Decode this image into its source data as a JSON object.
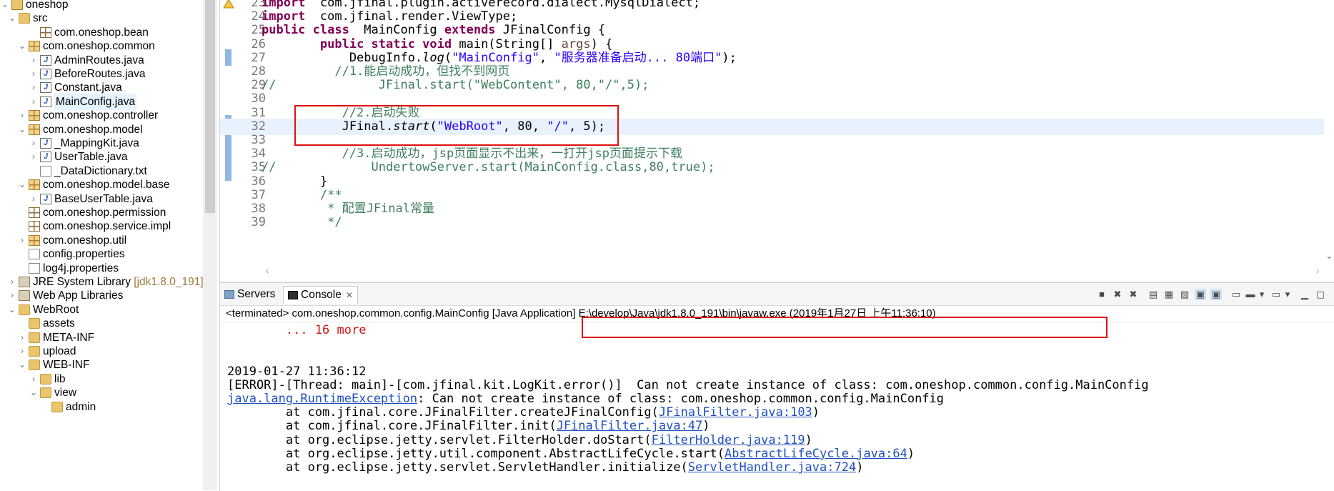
{
  "explorer": {
    "items": [
      {
        "label": "oneshop",
        "chev": "⌄",
        "icon": "proj"
      },
      {
        "label": "src",
        "chev": "⌄",
        "icon": "src"
      },
      {
        "label": "com.oneshop.bean",
        "chev": "",
        "icon": "pkg"
      },
      {
        "label": "com.oneshop.common",
        "chev": "⌄",
        "icon": "pkgfull"
      },
      {
        "label": "AdminRoutes.java",
        "chev": "›",
        "icon": "java"
      },
      {
        "label": "BeforeRoutes.java",
        "chev": "›",
        "icon": "java"
      },
      {
        "label": "Constant.java",
        "chev": "›",
        "icon": "java"
      },
      {
        "label": "MainConfig.java",
        "chev": "›",
        "icon": "java",
        "selected": true
      },
      {
        "label": "com.oneshop.controller",
        "chev": "›",
        "icon": "pkgfull"
      },
      {
        "label": "com.oneshop.model",
        "chev": "⌄",
        "icon": "pkgfull"
      },
      {
        "label": "_MappingKit.java",
        "chev": "›",
        "icon": "java"
      },
      {
        "label": "UserTable.java",
        "chev": "›",
        "icon": "java"
      },
      {
        "label": "_DataDictionary.txt",
        "chev": "",
        "icon": "file"
      },
      {
        "label": "com.oneshop.model.base",
        "chev": "⌄",
        "icon": "pkgfull"
      },
      {
        "label": "BaseUserTable.java",
        "chev": "›",
        "icon": "java"
      },
      {
        "label": "com.oneshop.permission",
        "chev": "",
        "icon": "pkg"
      },
      {
        "label": "com.oneshop.service.impl",
        "chev": "",
        "icon": "pkg"
      },
      {
        "label": "com.oneshop.util",
        "chev": "›",
        "icon": "pkgfull"
      },
      {
        "label": "config.properties",
        "chev": "",
        "icon": "file"
      },
      {
        "label": "log4j.properties",
        "chev": "",
        "icon": "file"
      },
      {
        "label": "JRE System Library",
        "deco": " [jdk1.8.0_191]",
        "chev": "›",
        "icon": "lib"
      },
      {
        "label": "Web App Libraries",
        "chev": "›",
        "icon": "lib"
      },
      {
        "label": "WebRoot",
        "chev": "⌄",
        "icon": "folder"
      },
      {
        "label": "assets",
        "chev": "",
        "icon": "folder"
      },
      {
        "label": "META-INF",
        "chev": "›",
        "icon": "folder"
      },
      {
        "label": "upload",
        "chev": "›",
        "icon": "folder"
      },
      {
        "label": "WEB-INF",
        "chev": "⌄",
        "icon": "folder"
      },
      {
        "label": "lib",
        "chev": "›",
        "icon": "folder"
      },
      {
        "label": "view",
        "chev": "⌄",
        "icon": "folder"
      },
      {
        "label": "admin",
        "chev": "",
        "icon": "folder"
      }
    ]
  },
  "editor": {
    "lines": [
      {
        "n": "23",
        "segs": [
          [
            "kw",
            "import"
          ],
          [
            "",
            "  com.jfinal.plugin.activerecord.dialect.MysqlDialect;"
          ]
        ]
      },
      {
        "n": "24",
        "segs": [
          [
            "kw",
            "import"
          ],
          [
            "",
            "  com.jfinal.render.ViewType;"
          ]
        ]
      },
      {
        "n": "25",
        "segs": [
          [
            "kw",
            "public class"
          ],
          [
            "",
            "  MainConfig "
          ],
          [
            "kw",
            "extends"
          ],
          [
            "",
            " JFinalConfig {"
          ]
        ]
      },
      {
        "n": "26",
        "segs": [
          [
            "",
            "        "
          ],
          [
            "kw",
            "public static void"
          ],
          [
            "",
            " main(String[] "
          ],
          [
            "param",
            "args"
          ],
          [
            "",
            ") {"
          ]
        ]
      },
      {
        "n": "27",
        "segs": [
          [
            "",
            "            DebugInfo."
          ],
          [
            "italic",
            "log"
          ],
          [
            "",
            "("
          ],
          [
            "str",
            "\"MainConfig\""
          ],
          [
            "",
            ", "
          ],
          [
            "str",
            "\"服务器准备启动... 80端口\""
          ],
          [
            "",
            ");"
          ]
        ]
      },
      {
        "n": "28",
        "segs": [
          [
            "cmt",
            "          //1.能启动成功，但找不到网页"
          ]
        ]
      },
      {
        "n": "29",
        "segs": [
          [
            "cmt",
            "//              JFinal.start(\"WebContent\", 80,\"/\",5);"
          ]
        ]
      },
      {
        "n": "30",
        "segs": [
          [
            "",
            ""
          ]
        ]
      },
      {
        "n": "31",
        "segs": [
          [
            "cmt",
            "           //2.启动失败"
          ]
        ]
      },
      {
        "n": "32",
        "segs": [
          [
            "",
            "           JFinal."
          ],
          [
            "italic",
            "start"
          ],
          [
            "",
            "("
          ],
          [
            "str",
            "\"WebRoot\""
          ],
          [
            "",
            ", 80, "
          ],
          [
            "str",
            "\"/\""
          ],
          [
            "",
            ", 5);"
          ]
        ]
      },
      {
        "n": "33",
        "segs": [
          [
            "",
            ""
          ]
        ]
      },
      {
        "n": "34",
        "segs": [
          [
            "cmt",
            "           //3.启动成功，jsp页面显示不出来，一打开jsp页面提示下载"
          ]
        ]
      },
      {
        "n": "35",
        "segs": [
          [
            "cmt",
            "//             UndertowServer.start(MainConfig.class,80,true);"
          ]
        ]
      },
      {
        "n": "36",
        "segs": [
          [
            "",
            "        }"
          ]
        ]
      },
      {
        "n": "37",
        "segs": [
          [
            "cmt",
            "        /**"
          ]
        ]
      },
      {
        "n": "38",
        "segs": [
          [
            "cmt",
            "         * 配置JFinal常量"
          ]
        ]
      },
      {
        "n": "39",
        "segs": [
          [
            "cmt",
            "         */"
          ]
        ]
      }
    ]
  },
  "console": {
    "tabs": {
      "servers": "Servers",
      "console": "Console"
    },
    "status": "<terminated> com.oneshop.common.config.MainConfig [Java Application] E:\\develop\\Java\\jdk1.8.0_191\\bin\\javaw.exe (2019年1月27日 上午11:36:10)",
    "lines": [
      {
        "type": "err",
        "segs": [
          [
            "",
            "        ... 16 more"
          ]
        ]
      },
      {
        "type": "",
        "segs": [
          [
            "",
            ""
          ]
        ]
      },
      {
        "type": "",
        "segs": [
          [
            "",
            ""
          ]
        ]
      },
      {
        "type": "",
        "segs": [
          [
            "",
            "2019-01-27 11:36:12"
          ]
        ]
      },
      {
        "type": "",
        "segs": [
          [
            "",
            "[ERROR]-[Thread: main]-[com.jfinal.kit.LogKit.error()]  Can not create instance of class: com.oneshop.common.config.MainConfig"
          ]
        ]
      },
      {
        "type": "",
        "segs": [
          [
            "link",
            "java.lang.RuntimeException"
          ],
          [
            "",
            ": Can not create instance of class: com.oneshop.common.config.MainConfig"
          ]
        ]
      },
      {
        "type": "",
        "segs": [
          [
            "",
            "        at com.jfinal.core.JFinalFilter.createJFinalConfig("
          ],
          [
            "link",
            "JFinalFilter.java:103"
          ],
          [
            "",
            ")"
          ]
        ]
      },
      {
        "type": "",
        "segs": [
          [
            "",
            "        at com.jfinal.core.JFinalFilter.init("
          ],
          [
            "link",
            "JFinalFilter.java:47"
          ],
          [
            "",
            ")"
          ]
        ]
      },
      {
        "type": "",
        "segs": [
          [
            "",
            "        at org.eclipse.jetty.servlet.FilterHolder.doStart("
          ],
          [
            "link",
            "FilterHolder.java:119"
          ],
          [
            "",
            ")"
          ]
        ]
      },
      {
        "type": "",
        "segs": [
          [
            "",
            "        at org.eclipse.jetty.util.component.AbstractLifeCycle.start("
          ],
          [
            "link",
            "AbstractLifeCycle.java:64"
          ],
          [
            "",
            ")"
          ]
        ]
      },
      {
        "type": "",
        "segs": [
          [
            "",
            "        at org.eclipse.jetty.servlet.ServletHandler.initialize("
          ],
          [
            "link",
            "ServletHandler.java:724"
          ],
          [
            "",
            ")"
          ]
        ]
      }
    ]
  }
}
